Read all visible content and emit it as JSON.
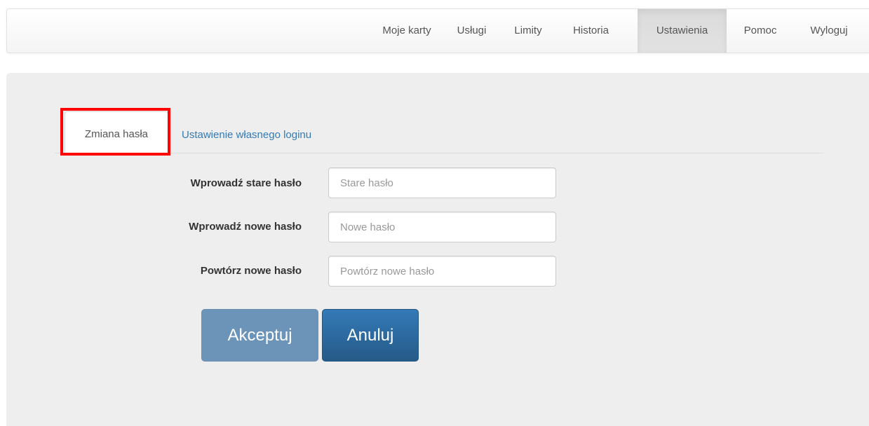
{
  "nav": {
    "items": [
      {
        "label": "Moje karty",
        "active": false
      },
      {
        "label": "Usługi",
        "active": false
      },
      {
        "label": "Limity",
        "active": false
      },
      {
        "label": "Historia",
        "active": false
      },
      {
        "label": "Ustawienia",
        "active": true
      },
      {
        "label": "Pomoc",
        "active": false
      },
      {
        "label": "Wyloguj",
        "active": false
      }
    ]
  },
  "tabs": {
    "active_label": "Zmiana hasła",
    "inactive_label": "Ustawienie własnego loginu"
  },
  "form": {
    "old_password": {
      "label": "Wprowadź stare hasło",
      "placeholder": "Stare hasło",
      "value": ""
    },
    "new_password": {
      "label": "Wprowadź nowe hasło",
      "placeholder": "Nowe hasło",
      "value": ""
    },
    "repeat_password": {
      "label": "Powtórz nowe hasło",
      "placeholder": "Powtórz nowe hasło",
      "value": ""
    }
  },
  "buttons": {
    "accept_label": "Akceptuj",
    "cancel_label": "Anuluj"
  },
  "colors": {
    "highlight": "#ff0000",
    "link": "#337ab7",
    "primary_button": "#337ab7",
    "disabled_button": "#6c93b8"
  }
}
